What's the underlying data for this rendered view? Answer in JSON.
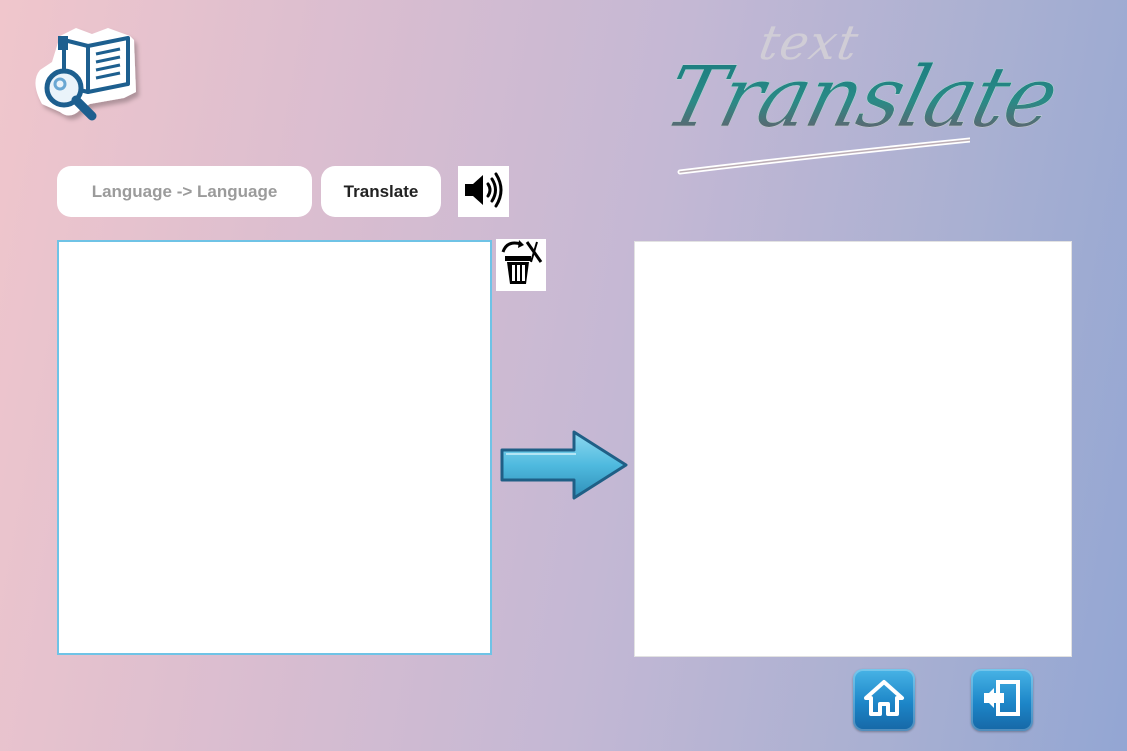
{
  "header": {
    "title_small": "text",
    "title_big": "Translate"
  },
  "toolbar": {
    "language_label": "Language -> Language",
    "translate_label": "Translate"
  },
  "icons": {
    "app_logo": "book-magnifier-icon",
    "speaker": "speaker-icon",
    "clear": "trash-clear-icon",
    "arrow": "arrow-right-icon",
    "home": "home-icon",
    "exit": "exit-icon"
  },
  "editor": {
    "source_value": "",
    "output_value": ""
  },
  "colors": {
    "accent_blue": "#1d86c8",
    "title_teal": "#1a7c7f",
    "input_border": "#6fc3e6"
  }
}
